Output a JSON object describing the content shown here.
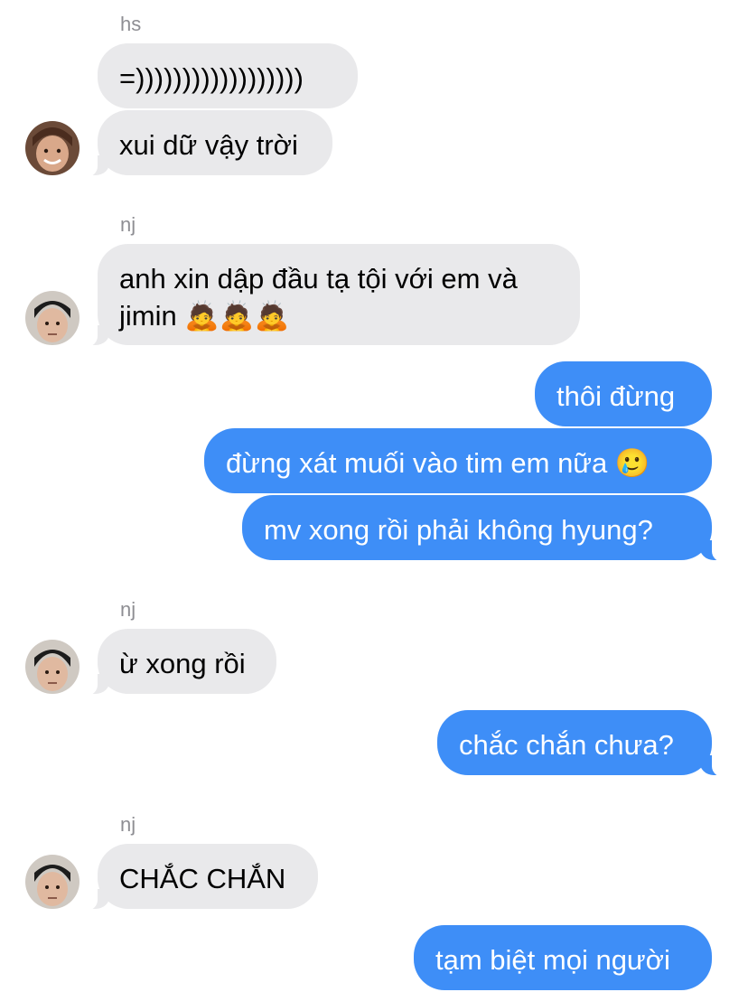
{
  "messages": [
    {
      "sender": "hs"
    },
    {
      "text": "=))))))))))))))))))"
    },
    {
      "text": "xui dữ vậy trời"
    },
    {
      "sender": "nj"
    },
    {
      "line1": "anh xin dập đầu tạ tội với em và",
      "line2": "jimin 🙇🙇🙇"
    },
    {
      "text": "thôi đừng"
    },
    {
      "text": "đừng xát muối vào tim em nữa 🥲"
    },
    {
      "text": "mv xong rồi phải không hyung?"
    },
    {
      "sender": "nj"
    },
    {
      "text": "ừ xong rồi"
    },
    {
      "text": "chắc chắn chưa?"
    },
    {
      "sender": "nj"
    },
    {
      "text": "CHẮC CHẮN"
    },
    {
      "text": "tạm biệt mọi người"
    }
  ],
  "colors": {
    "incoming_bubble": "#e9e9eb",
    "outgoing_bubble": "#3e8ef7",
    "sender_label": "#8e8e93"
  }
}
